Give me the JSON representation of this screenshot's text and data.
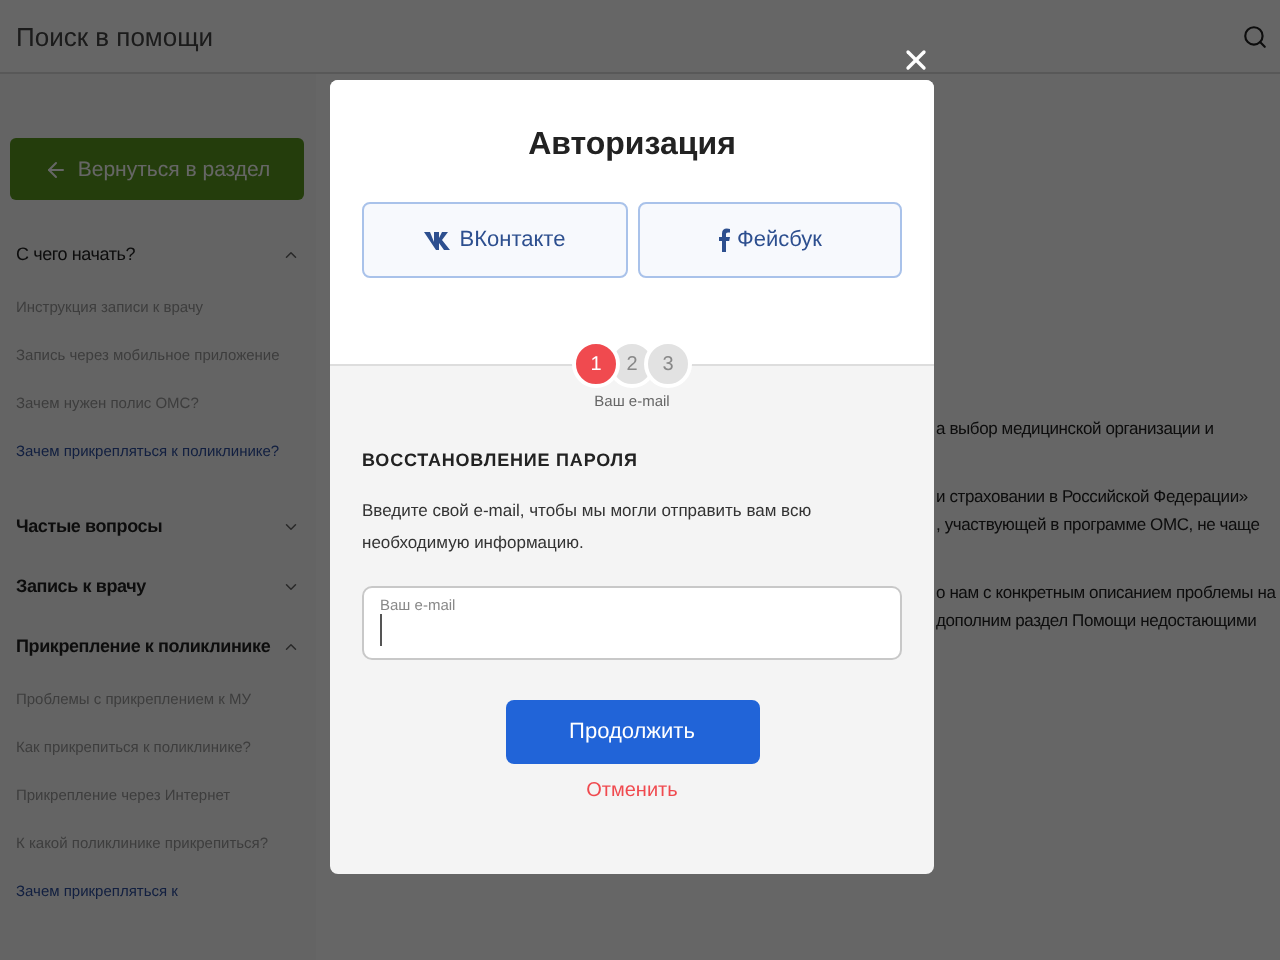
{
  "search": {
    "placeholder": "Поиск в помощи"
  },
  "back_button": {
    "label": "Вернуться в раздел"
  },
  "sidebar": {
    "sections": [
      {
        "title": "С чего начать?",
        "expanded": true,
        "items": [
          {
            "label": "Инструкция записи к врачу",
            "selected": false
          },
          {
            "label": "Запись через мобильное приложение",
            "selected": false
          },
          {
            "label": "Зачем нужен полис ОМС?",
            "selected": false
          },
          {
            "label": "Зачем прикрепляться к поликлинике?",
            "selected": true
          }
        ]
      },
      {
        "title": "Частые вопросы",
        "expanded": false
      },
      {
        "title": "Запись к врачу",
        "expanded": false
      },
      {
        "title": "Прикрепление к поликлинике",
        "expanded": true,
        "items": [
          {
            "label": "Проблемы с прикреплением к МУ",
            "selected": false
          },
          {
            "label": "Как прикрепиться к поликлинике?",
            "selected": false
          },
          {
            "label": "Прикрепление через Интернет",
            "selected": false
          },
          {
            "label": "К какой поликлинике прикрепиться?",
            "selected": false
          },
          {
            "label": "Зачем прикрепляться к",
            "selected": true
          }
        ]
      }
    ]
  },
  "content": {
    "paragraphs": [
      [
        "а выбор медицинской организации и"
      ],
      [
        "и страховании в Российской Федерации»",
        ", участвующей в программе ОМС, не чаще"
      ],
      [
        "о нам с конкретным описанием проблемы на",
        "дополним раздел Помощи недостающими"
      ]
    ]
  },
  "modal": {
    "title": "Авторизация",
    "social_buttons": [
      {
        "kind": "vk",
        "label": "ВКонтакте"
      },
      {
        "kind": "facebook",
        "label": "Фейсбук"
      }
    ],
    "steps": [
      {
        "label": "1",
        "selected": true
      },
      {
        "label": "2",
        "selected": false
      },
      {
        "label": "3",
        "selected": false
      }
    ],
    "step_caption": "Ваш e-mail",
    "heading": "ВОССТАНОВЛЕНИЕ ПАРОЛЯ",
    "description": "Введите свой e-mail, чтобы мы могли отправить вам всю необходимую информацию.",
    "email_field": {
      "label": "Ваш e-mail"
    },
    "primary_button": "Продолжить",
    "cancel_link": "Отменить"
  }
}
